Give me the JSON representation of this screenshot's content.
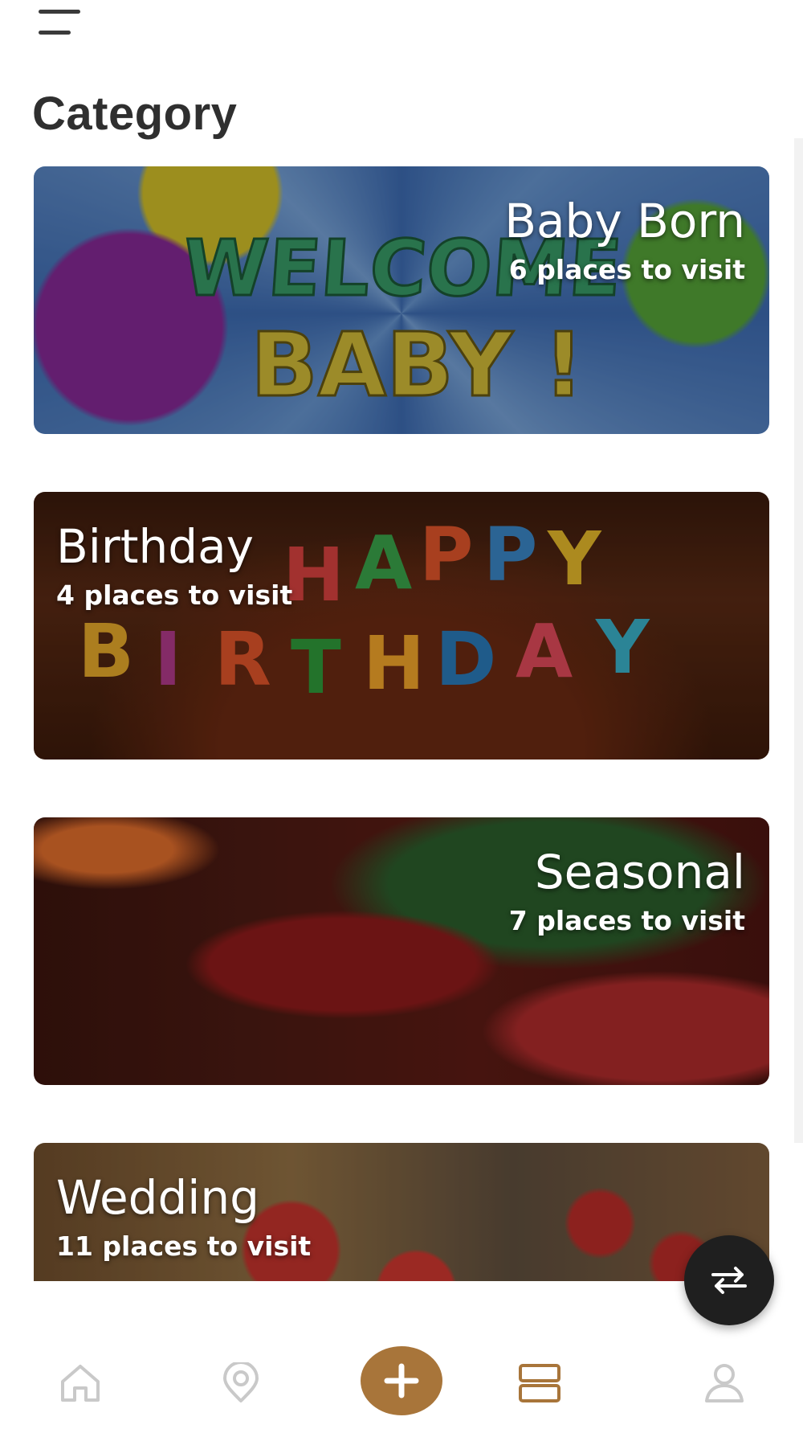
{
  "header": {
    "menu_icon": "hamburger-menu-icon",
    "title": "Category"
  },
  "categories": [
    {
      "name": "Baby Born",
      "count": "6 places to visit",
      "align": "right"
    },
    {
      "name": "Birthday",
      "count": "4 places to visit",
      "align": "left"
    },
    {
      "name": "Seasonal",
      "count": "7 places to visit",
      "align": "right"
    },
    {
      "name": "Wedding",
      "count": "11 places to visit",
      "align": "left"
    }
  ],
  "fab": {
    "icon": "swap-arrows-icon"
  },
  "bottom_nav": {
    "items": [
      {
        "icon": "home-icon",
        "active": false
      },
      {
        "icon": "map-pin-icon",
        "active": false
      },
      {
        "icon": "plus-icon",
        "active": false
      },
      {
        "icon": "list-view-icon",
        "active": true
      },
      {
        "icon": "user-icon",
        "active": false
      }
    ]
  },
  "colors": {
    "accent": "#a8753a",
    "text_dark": "#2f2f2f",
    "nav_inactive": "#c9c9c9",
    "fab_bg": "#1f1f1f"
  }
}
